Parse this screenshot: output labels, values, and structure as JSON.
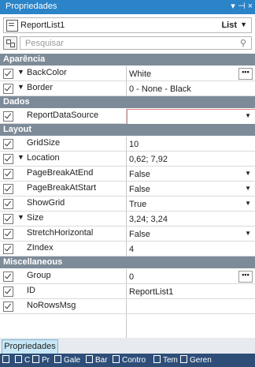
{
  "panel": {
    "title": "Propriedades",
    "pin_icon": "pin-icon",
    "close_icon": "close-icon"
  },
  "object_selector": {
    "name": "ReportList1",
    "type": "List"
  },
  "search": {
    "placeholder": "Pesquisar"
  },
  "categories": [
    {
      "label": "Aparência",
      "rows": [
        {
          "name": "BackColor",
          "value": "White",
          "expand": true,
          "editor": "ellipsis"
        },
        {
          "name": "Border",
          "value": "0 - None - Black",
          "expand": true,
          "editor": "none"
        }
      ]
    },
    {
      "label": "Dados",
      "rows": [
        {
          "name": "ReportDataSource",
          "value": "",
          "expand": false,
          "editor": "dropdown-active"
        }
      ]
    },
    {
      "label": "Layout",
      "rows": [
        {
          "name": "GridSize",
          "value": "10",
          "expand": false,
          "editor": "none"
        },
        {
          "name": "Location",
          "value": "0,62; 7,92",
          "expand": true,
          "editor": "none"
        },
        {
          "name": "PageBreakAtEnd",
          "value": "False",
          "expand": false,
          "editor": "dropdown"
        },
        {
          "name": "PageBreakAtStart",
          "value": "False",
          "expand": false,
          "editor": "dropdown"
        },
        {
          "name": "ShowGrid",
          "value": "True",
          "expand": false,
          "editor": "dropdown"
        },
        {
          "name": "Size",
          "value": "3,24; 3,24",
          "expand": true,
          "editor": "none"
        },
        {
          "name": "StretchHorizontal",
          "value": "False",
          "expand": false,
          "editor": "dropdown"
        },
        {
          "name": "ZIndex",
          "value": "4",
          "expand": false,
          "editor": "none"
        }
      ]
    },
    {
      "label": "Miscellaneous",
      "rows": [
        {
          "name": "Group",
          "value": "0",
          "expand": false,
          "editor": "ellipsis"
        },
        {
          "name": "ID",
          "value": "ReportList1",
          "expand": false,
          "editor": "none"
        },
        {
          "name": "NoRowsMsg",
          "value": "",
          "expand": false,
          "editor": "none"
        }
      ]
    }
  ],
  "bottom_tab": "Propriedades",
  "toolbar": [
    {
      "icon": "plus-icon",
      "label": ""
    },
    {
      "icon": "tools-icon",
      "label": "C"
    },
    {
      "icon": "page-icon",
      "label": "Pr"
    },
    {
      "icon": "gallery-icon",
      "label": "Gale"
    },
    {
      "icon": "database-icon",
      "label": "Bar"
    },
    {
      "icon": "control-icon",
      "label": "Contro"
    },
    {
      "icon": "template-icon",
      "label": "Tem"
    },
    {
      "icon": "manager-icon",
      "label": "Geren"
    }
  ],
  "colors": {
    "titlebar": "#2b83c8",
    "category": "#7d8b99",
    "toolbar": "#2e4e78",
    "tab": "#c7e7f6"
  }
}
